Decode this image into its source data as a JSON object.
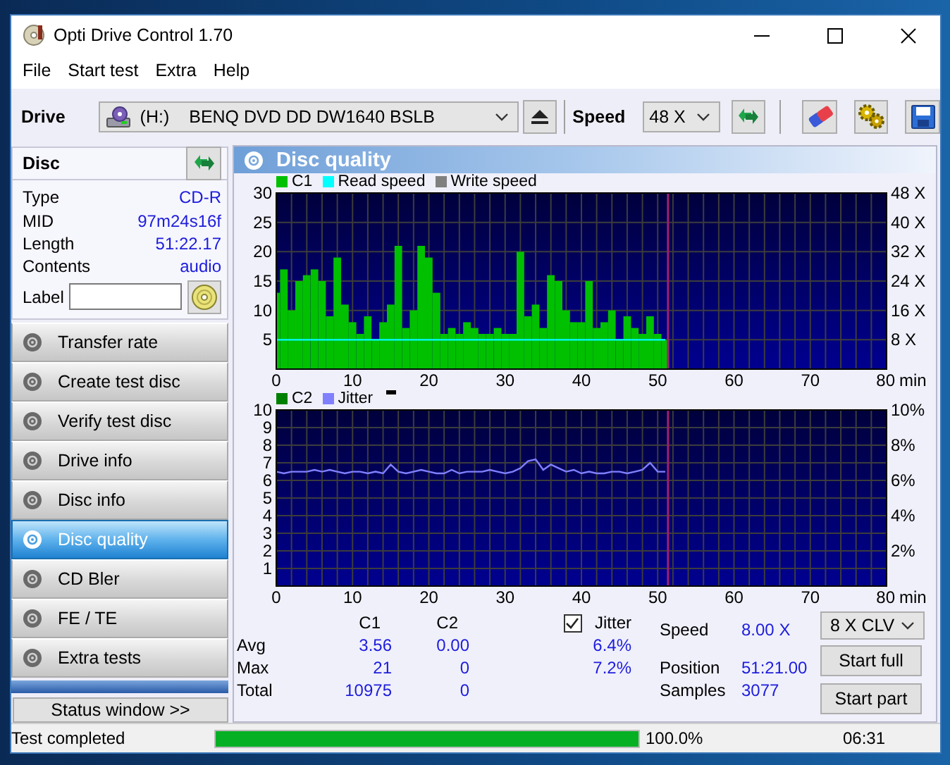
{
  "window": {
    "title": "Opti Drive Control 1.70"
  },
  "menu": [
    "File",
    "Start test",
    "Extra",
    "Help"
  ],
  "toolbar": {
    "drive_label": "Drive",
    "drive": {
      "letter": "(H:)",
      "name": "BENQ DVD DD DW1640 BSLB"
    },
    "speed_label": "Speed",
    "speed": "48 X"
  },
  "disc": {
    "title": "Disc",
    "fields": [
      {
        "kind": "text",
        "label": "Type",
        "value": "CD-R"
      },
      {
        "kind": "text",
        "label": "MID",
        "value": "97m24s16f"
      },
      {
        "kind": "text",
        "label": "Length",
        "value": "51:22.17"
      },
      {
        "kind": "text",
        "label": "Contents",
        "value": "audio"
      },
      {
        "kind": "input",
        "label": "Label"
      }
    ]
  },
  "nav": [
    {
      "label": "Transfer rate",
      "selected": false
    },
    {
      "label": "Create test disc",
      "selected": false
    },
    {
      "label": "Verify test disc",
      "selected": false
    },
    {
      "label": "Drive info",
      "selected": false
    },
    {
      "label": "Disc info",
      "selected": false
    },
    {
      "label": "Disc quality",
      "selected": true
    },
    {
      "label": "CD Bler",
      "selected": false
    },
    {
      "label": "FE / TE",
      "selected": false
    },
    {
      "label": "Extra tests",
      "selected": false
    }
  ],
  "status_button": "Status window >>",
  "panel": {
    "title": "Disc quality",
    "charts": [
      {
        "chart_data": {
          "type": "bar",
          "x": [
            0,
            1,
            2,
            3,
            4,
            5,
            6,
            7,
            8,
            9,
            10,
            11,
            12,
            13,
            14,
            15,
            16,
            17,
            18,
            19,
            20,
            21,
            22,
            23,
            24,
            25,
            26,
            27,
            28,
            29,
            30,
            31,
            32,
            33,
            34,
            35,
            36,
            37,
            38,
            39,
            40,
            41,
            42,
            43,
            44,
            45,
            46,
            47,
            48,
            49,
            50,
            51
          ],
          "series": [
            {
              "name": "C1",
              "color": "#00c000",
              "values": [
                13,
                17,
                10,
                15,
                16,
                17,
                15,
                9,
                19,
                11,
                8,
                6,
                9,
                5,
                8,
                11,
                21,
                7,
                10,
                21,
                19,
                13,
                6,
                7,
                6,
                8,
                7,
                6,
                6,
                7,
                6,
                6,
                20,
                9,
                11,
                7,
                16,
                15,
                10,
                8,
                8,
                15,
                7,
                8,
                10,
                5,
                9,
                7,
                6,
                9,
                6,
                5
              ]
            },
            {
              "name": "Read speed",
              "color": "#00ffff",
              "type": "line",
              "axis": "y2",
              "values": [
                8,
                8,
                8,
                8,
                8,
                8,
                8,
                8,
                8,
                8,
                8,
                8,
                8,
                8,
                8,
                8,
                8,
                8,
                8,
                8,
                8,
                8,
                8,
                8,
                8,
                8,
                8,
                8,
                8,
                8,
                8,
                8,
                8,
                8,
                8,
                8,
                8,
                8,
                8,
                8,
                8,
                8,
                8,
                8,
                8,
                8,
                8,
                8,
                8,
                8,
                8,
                8
              ]
            },
            {
              "name": "Write speed",
              "color": "#808080",
              "type": "line",
              "axis": "y2",
              "values": [
                null,
                null,
                null,
                null,
                null,
                null,
                null,
                null,
                null,
                null,
                null,
                null,
                null,
                null,
                null,
                null,
                null,
                null,
                null,
                null,
                null,
                null,
                null,
                null,
                null,
                null,
                null,
                null,
                null,
                null,
                null,
                null,
                null,
                null,
                null,
                null,
                null,
                null,
                null,
                null,
                null,
                null,
                null,
                null,
                null,
                null,
                null,
                null,
                null,
                null,
                null,
                null
              ]
            }
          ],
          "xlim": [
            0,
            80
          ],
          "ylim": [
            0,
            30
          ],
          "y2lim": [
            0,
            48
          ],
          "xlabel": "min",
          "xticks": [
            0,
            10,
            20,
            30,
            40,
            50,
            60,
            70,
            80
          ],
          "yticks": [
            5,
            10,
            15,
            20,
            25,
            30
          ],
          "y2ticks": [
            {
              "value": 8,
              "label": "8 X"
            },
            {
              "value": 16,
              "label": "16 X"
            },
            {
              "value": 24,
              "label": "24 X"
            },
            {
              "value": 32,
              "label": "32 X"
            },
            {
              "value": 40,
              "label": "40 X"
            },
            {
              "value": 48,
              "label": "48 X"
            }
          ],
          "grid": true,
          "ref_lines": [
            {
              "axis": "x",
              "value": 51.35,
              "color": "#a0206e"
            }
          ]
        }
      },
      {
        "show_marker": true,
        "chart_data": {
          "type": "bar",
          "x": [
            0,
            1,
            2,
            3,
            4,
            5,
            6,
            7,
            8,
            9,
            10,
            11,
            12,
            13,
            14,
            15,
            16,
            17,
            18,
            19,
            20,
            21,
            22,
            23,
            24,
            25,
            26,
            27,
            28,
            29,
            30,
            31,
            32,
            33,
            34,
            35,
            36,
            37,
            38,
            39,
            40,
            41,
            42,
            43,
            44,
            45,
            46,
            47,
            48,
            49,
            50,
            51
          ],
          "series": [
            {
              "name": "C2",
              "color": "#008000",
              "values": [
                0,
                0,
                0,
                0,
                0,
                0,
                0,
                0,
                0,
                0,
                0,
                0,
                0,
                0,
                0,
                0,
                0,
                0,
                0,
                0,
                0,
                0,
                0,
                0,
                0,
                0,
                0,
                0,
                0,
                0,
                0,
                0,
                0,
                0,
                0,
                0,
                0,
                0,
                0,
                0,
                0,
                0,
                0,
                0,
                0,
                0,
                0,
                0,
                0,
                0,
                0,
                0
              ]
            },
            {
              "name": "Jitter",
              "color": "#8080ff",
              "type": "line",
              "values": [
                6.5,
                6.4,
                6.5,
                6.5,
                6.5,
                6.6,
                6.5,
                6.6,
                6.5,
                6.4,
                6.5,
                6.5,
                6.4,
                6.5,
                6.4,
                6.9,
                6.5,
                6.4,
                6.5,
                6.6,
                6.5,
                6.4,
                6.4,
                6.6,
                6.4,
                6.5,
                6.5,
                6.5,
                6.6,
                6.5,
                6.4,
                6.5,
                6.7,
                7.1,
                7.2,
                6.6,
                6.9,
                6.7,
                6.5,
                6.6,
                6.4,
                6.5,
                6.4,
                6.4,
                6.5,
                6.5,
                6.4,
                6.5,
                6.6,
                7.0,
                6.5,
                6.5
              ]
            }
          ],
          "xlim": [
            0,
            80
          ],
          "ylim": [
            0,
            10
          ],
          "y2lim": [
            0,
            10
          ],
          "xlabel": "min",
          "xticks": [
            0,
            10,
            20,
            30,
            40,
            50,
            60,
            70,
            80
          ],
          "yticks": [
            1,
            2,
            3,
            4,
            5,
            6,
            7,
            8,
            9,
            10
          ],
          "y2ticks": [
            {
              "value": 2,
              "label": "2%"
            },
            {
              "value": 4,
              "label": "4%"
            },
            {
              "value": 6,
              "label": "6%"
            },
            {
              "value": 8,
              "label": "8%"
            },
            {
              "value": 10,
              "label": "10%"
            }
          ],
          "grid": true,
          "ref_lines": [
            {
              "axis": "x",
              "value": 51.35,
              "color": "#a0206e"
            }
          ]
        }
      }
    ]
  },
  "stats": {
    "columns": [
      "C1",
      "C2"
    ],
    "rows": [
      {
        "label": "Avg",
        "c1": "3.56",
        "c2": "0.00",
        "jitter": "6.4%"
      },
      {
        "label": "Max",
        "c1": "21",
        "c2": "0",
        "jitter": "7.2%"
      },
      {
        "label": "Total",
        "c1": "10975",
        "c2": "0"
      }
    ],
    "jitter": {
      "label": "Jitter",
      "checked": true
    },
    "readouts": [
      {
        "label": "Speed",
        "value": "8.00 X"
      },
      {
        "label": "Position",
        "value": "51:21.00"
      },
      {
        "label": "Samples",
        "value": "3077"
      }
    ],
    "speed_mode": "8 X CLV",
    "buttons": [
      "Start full",
      "Start part"
    ]
  },
  "status_bar": {
    "message": "Test completed",
    "level": 1,
    "percent": "100.0%",
    "time": "06:31"
  }
}
